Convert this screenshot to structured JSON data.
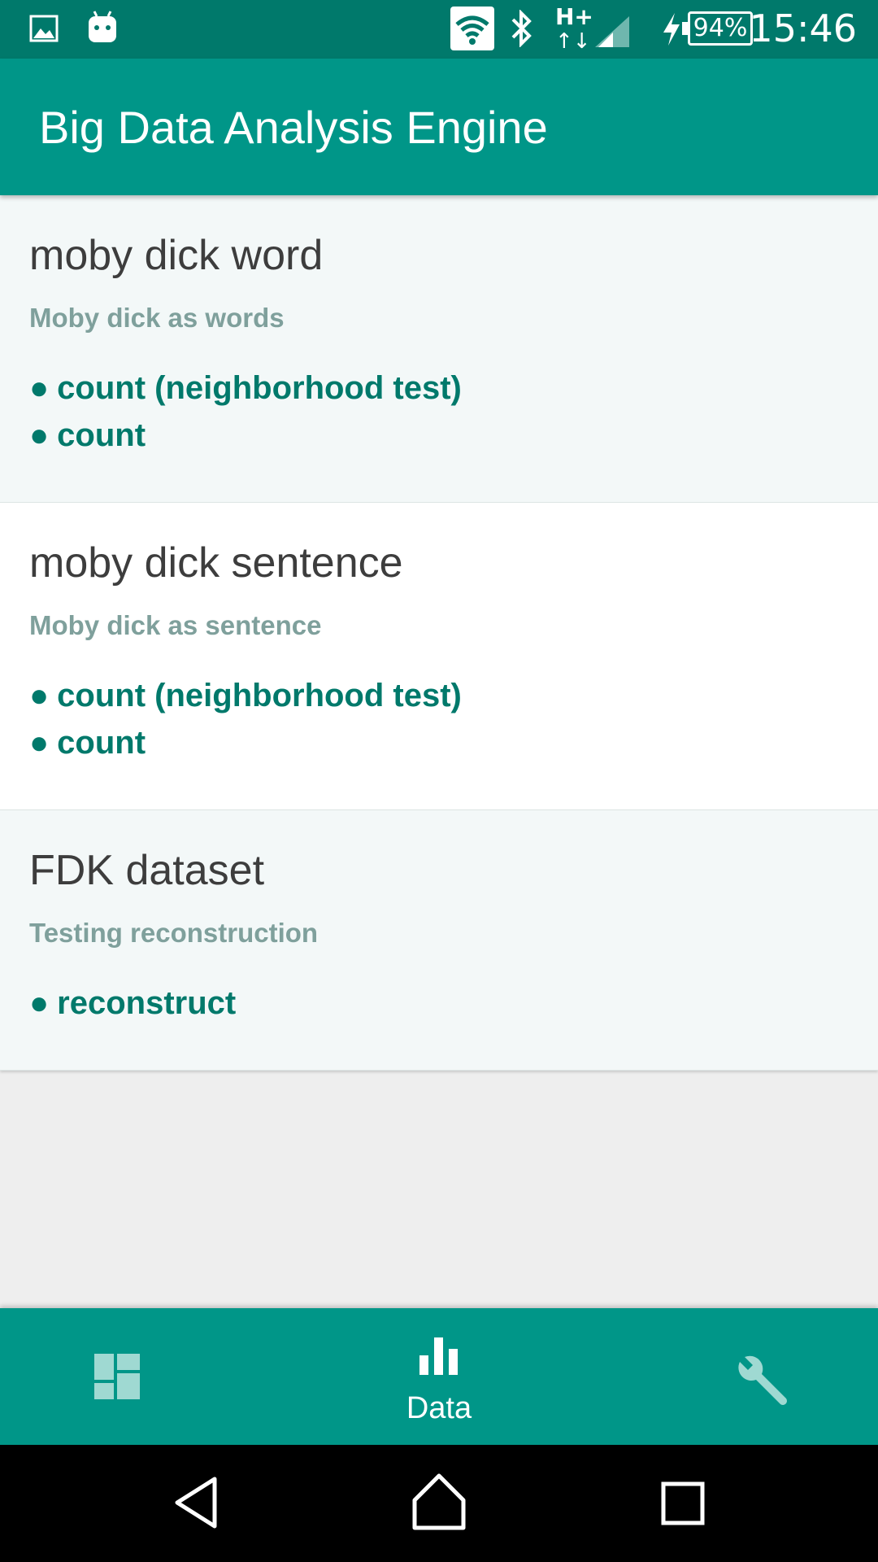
{
  "status_bar": {
    "time": "15:46",
    "battery": "94%",
    "network": "H+",
    "icons": [
      "gallery-notification-icon",
      "android-notification-icon",
      "wifi-icon",
      "bluetooth-icon",
      "cell-signal-icon",
      "charging-icon",
      "battery-icon"
    ]
  },
  "app_bar": {
    "title": "Big Data Analysis Engine"
  },
  "datasets": [
    {
      "title": "moby dick word",
      "description": "Moby dick as words",
      "operations": [
        "count (neighborhood test)",
        "count"
      ]
    },
    {
      "title": "moby dick sentence",
      "description": "Moby dick as sentence",
      "operations": [
        "count (neighborhood test)",
        "count"
      ]
    },
    {
      "title": "FDK dataset",
      "description": "Testing reconstruction",
      "operations": [
        "reconstruct"
      ]
    }
  ],
  "bullet": "●",
  "bottom_nav": {
    "tabs": [
      {
        "icon": "dashboard-icon",
        "label": "",
        "active": false
      },
      {
        "icon": "bar-chart-icon",
        "label": "Data",
        "active": true
      },
      {
        "icon": "wrench-icon",
        "label": "",
        "active": false
      }
    ]
  },
  "colors": {
    "primary": "#009688",
    "primary_dark": "#00796b",
    "accent_text": "#00796b",
    "subtitle": "#7fa09c"
  }
}
